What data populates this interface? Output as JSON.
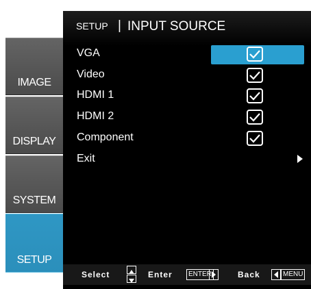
{
  "sidebar": {
    "tabs": [
      {
        "label": "IMAGE"
      },
      {
        "label": "DISPLAY"
      },
      {
        "label": "SYSTEM"
      },
      {
        "label": "SETUP",
        "active": true
      }
    ]
  },
  "header": {
    "section": "SETUP",
    "separator": "|",
    "title": "INPUT SOURCE"
  },
  "menu": {
    "items": [
      {
        "label": "VGA",
        "checked": true,
        "selected": true
      },
      {
        "label": "Video",
        "checked": true
      },
      {
        "label": "HDMI 1",
        "checked": true
      },
      {
        "label": "HDMI 2",
        "checked": true
      },
      {
        "label": "Component",
        "checked": true
      },
      {
        "label": "Exit",
        "icon": "arrow-right-icon"
      }
    ]
  },
  "footer": {
    "select_label": "Select",
    "enter_label": "Enter",
    "enter_key": "ENTER",
    "back_label": "Back",
    "menu_key": "MENU"
  },
  "colors": {
    "accent": "#2a9fd0",
    "panel_bg": "#000000",
    "tab_bg": "#555555"
  }
}
